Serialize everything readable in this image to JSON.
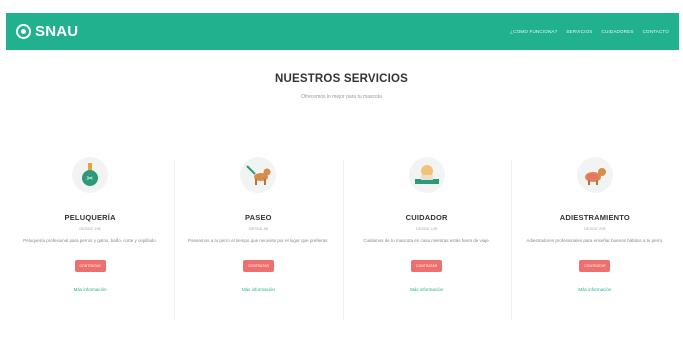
{
  "brand": {
    "name": "SNAU",
    "color": "#22b18f"
  },
  "nav": [
    "¿COMO FUNCIONA?",
    "SERVICIOS",
    "CUIDADORES",
    "CONTACTO"
  ],
  "section": {
    "title": "NUESTROS SERVICIOS",
    "subtitle": "Ofrecemos lo mejor para tu mascota"
  },
  "cards": [
    {
      "icon": "grooming-icon",
      "title": "PELUQUERÍA",
      "price": "DESDE 15€",
      "desc": "Peluquería profesional para perros y gatos, baño, corte y cepillado.",
      "button": "CONTRATAR",
      "more": "Más información"
    },
    {
      "icon": "dog-walk-icon",
      "title": "PASEO",
      "price": "DESDE 8€",
      "desc": "Paseamos a tu perro el tiempo que necesite por el lugar que prefieras.",
      "button": "CONTRATAR",
      "more": "Más información"
    },
    {
      "icon": "caretaker-icon",
      "title": "CUIDADOR",
      "price": "DESDE 12€",
      "desc": "Cuidamos de tu mascota en casa mientras estás fuera de viaje.",
      "button": "CONTRATAR",
      "more": "Más información"
    },
    {
      "icon": "training-icon",
      "title": "ADIESTRAMIENTO",
      "price": "DESDE 20€",
      "desc": "Adiestradores profesionales para enseñar buenos hábitos a tu perro.",
      "button": "CONTRATAR",
      "more": "Más información"
    }
  ],
  "colors": {
    "accent": "#22b18f",
    "button": "#ef6e6e"
  }
}
